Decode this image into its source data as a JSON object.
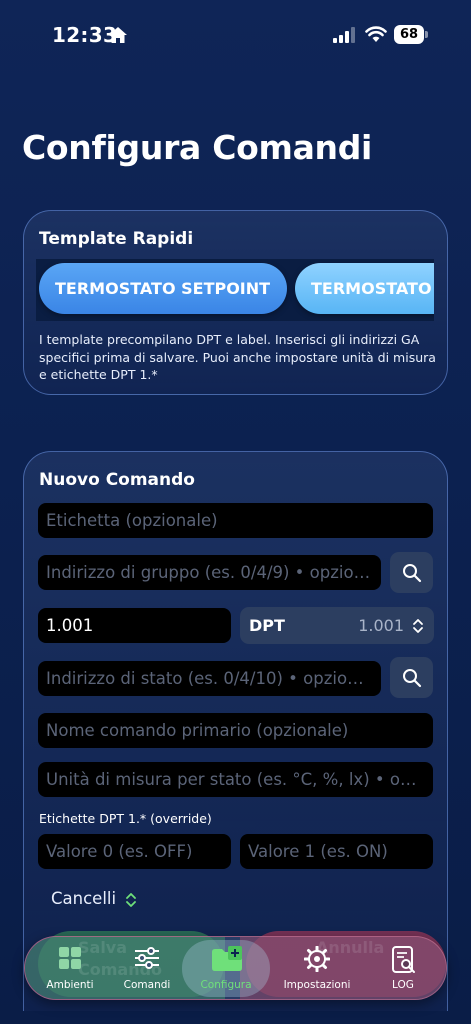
{
  "status_bar": {
    "time": "12:33",
    "battery": "68"
  },
  "page_title": "Configura Comandi",
  "templates": {
    "title": "Template Rapidi",
    "chips": [
      "TERMOSTATO SETPOINT",
      "TERMOSTATO"
    ],
    "hint": "I template precompilano DPT e label. Inserisci gli indirizzi GA specifici prima di salvare. Puoi anche impostare unità di misura e etichette DPT 1.*"
  },
  "new_command": {
    "title": "Nuovo Comando",
    "label_placeholder": "Etichetta (opzionale)",
    "group_address_placeholder": "Indirizzo di gruppo (es. 0/4/9) • opzionale",
    "dpt_input_value": "1.001",
    "dpt_select_label": "DPT",
    "dpt_select_value": "1.001",
    "status_address_placeholder": "Indirizzo di stato (es. 0/4/10) • opzionale",
    "primary_name_placeholder": "Nome comando primario (opzionale)",
    "unit_placeholder": "Unità di misura per stato (es. °C, %, lx) • opzionale",
    "dpt_labels_section": "Etichette DPT 1.* (override)",
    "value0_placeholder": "Valore 0 (es. OFF)",
    "value1_placeholder": "Valore 1 (es. ON)",
    "category": "Cancelli",
    "ghost_save": "Salva Comando",
    "ghost_cancel": "Annulla"
  },
  "tabs": [
    {
      "label": "Ambienti",
      "icon": "grid-icon"
    },
    {
      "label": "Comandi",
      "icon": "sliders-icon"
    },
    {
      "label": "Configura",
      "icon": "folder-plus-icon",
      "active": true
    },
    {
      "label": "Impostazioni",
      "icon": "gear-icon"
    },
    {
      "label": "LOG",
      "icon": "document-search-icon"
    }
  ],
  "colors": {
    "background": "#0f2557",
    "accent_blue": "#4a95ee",
    "active_tab": "#6fe07a",
    "field_bg": "#000000",
    "button_bg": "#2c3e60"
  }
}
